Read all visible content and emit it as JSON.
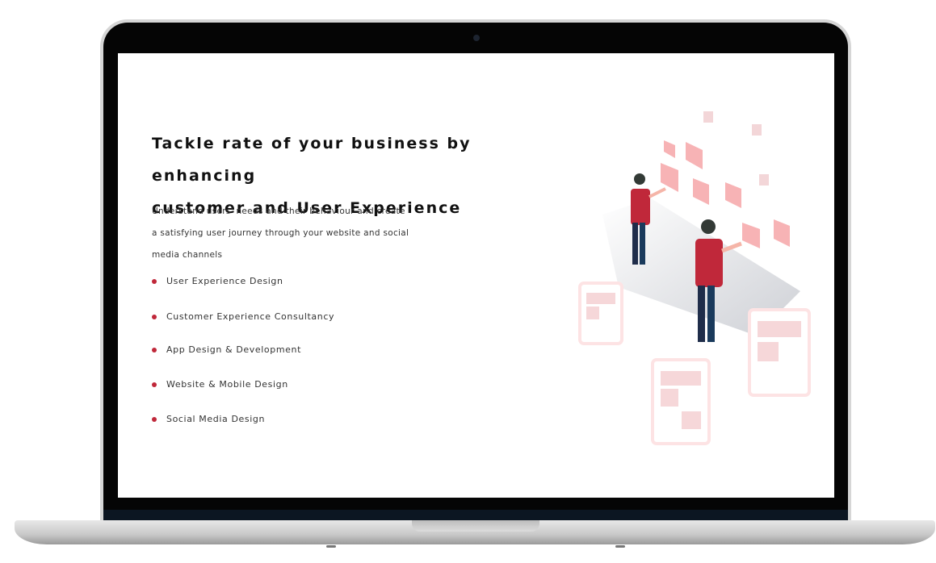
{
  "hero": {
    "title_line1": "Tackle rate of your business by enhancing",
    "title_line2": "customer and User Experience",
    "desc_line1": "Understand users' needs and their behaviour and create",
    "desc_line2": "a satisfying user journey through your website and social",
    "desc_line3": "media channels"
  },
  "services": [
    {
      "label": "User Experience Design"
    },
    {
      "label": "Customer Experience Consultancy"
    },
    {
      "label": "App Design & Development"
    },
    {
      "label": "Website & Mobile Design"
    },
    {
      "label": "Social Media Design"
    }
  ],
  "colors": {
    "accent": "#c0283a",
    "card": "#f7b3b5"
  }
}
